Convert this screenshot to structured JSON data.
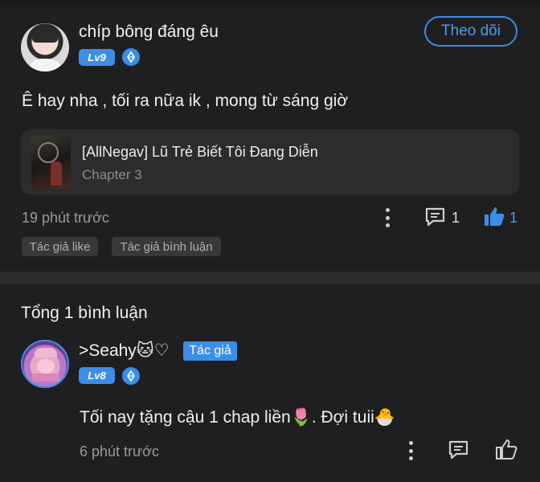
{
  "post": {
    "username": "chíp bông đáng êu",
    "level": "Lv9",
    "follow_label": "Theo dõi",
    "content": "Ê hay nha , tối ra nữa ik , mong từ sáng giờ",
    "book": {
      "title": "[AllNegav] Lũ Trẻ Biết Tôi Đang Diễn",
      "chapter": "Chapter 3"
    },
    "time": "19 phút trước",
    "comment_count": "1",
    "like_count": "1",
    "tags": [
      "Tác giả like",
      "Tác giả bình luận"
    ]
  },
  "comments_summary": "Tổng 1 bình luận",
  "reply": {
    "username": ">Seahy🐱♡",
    "author_badge": "Tác giả",
    "level": "Lv8",
    "content": "Tối nay tặng cậu 1 chap liền🌷. Đợi tuii🐣",
    "time": "6 phút trước"
  },
  "colors": {
    "background": "#1f1f21",
    "accent": "#3b8ee8",
    "card": "#2c2c2e",
    "muted_text": "#9a9a9a"
  },
  "icons": [
    "more-vertical-icon",
    "comment-icon",
    "thumbs-up-icon",
    "verified-icon"
  ]
}
